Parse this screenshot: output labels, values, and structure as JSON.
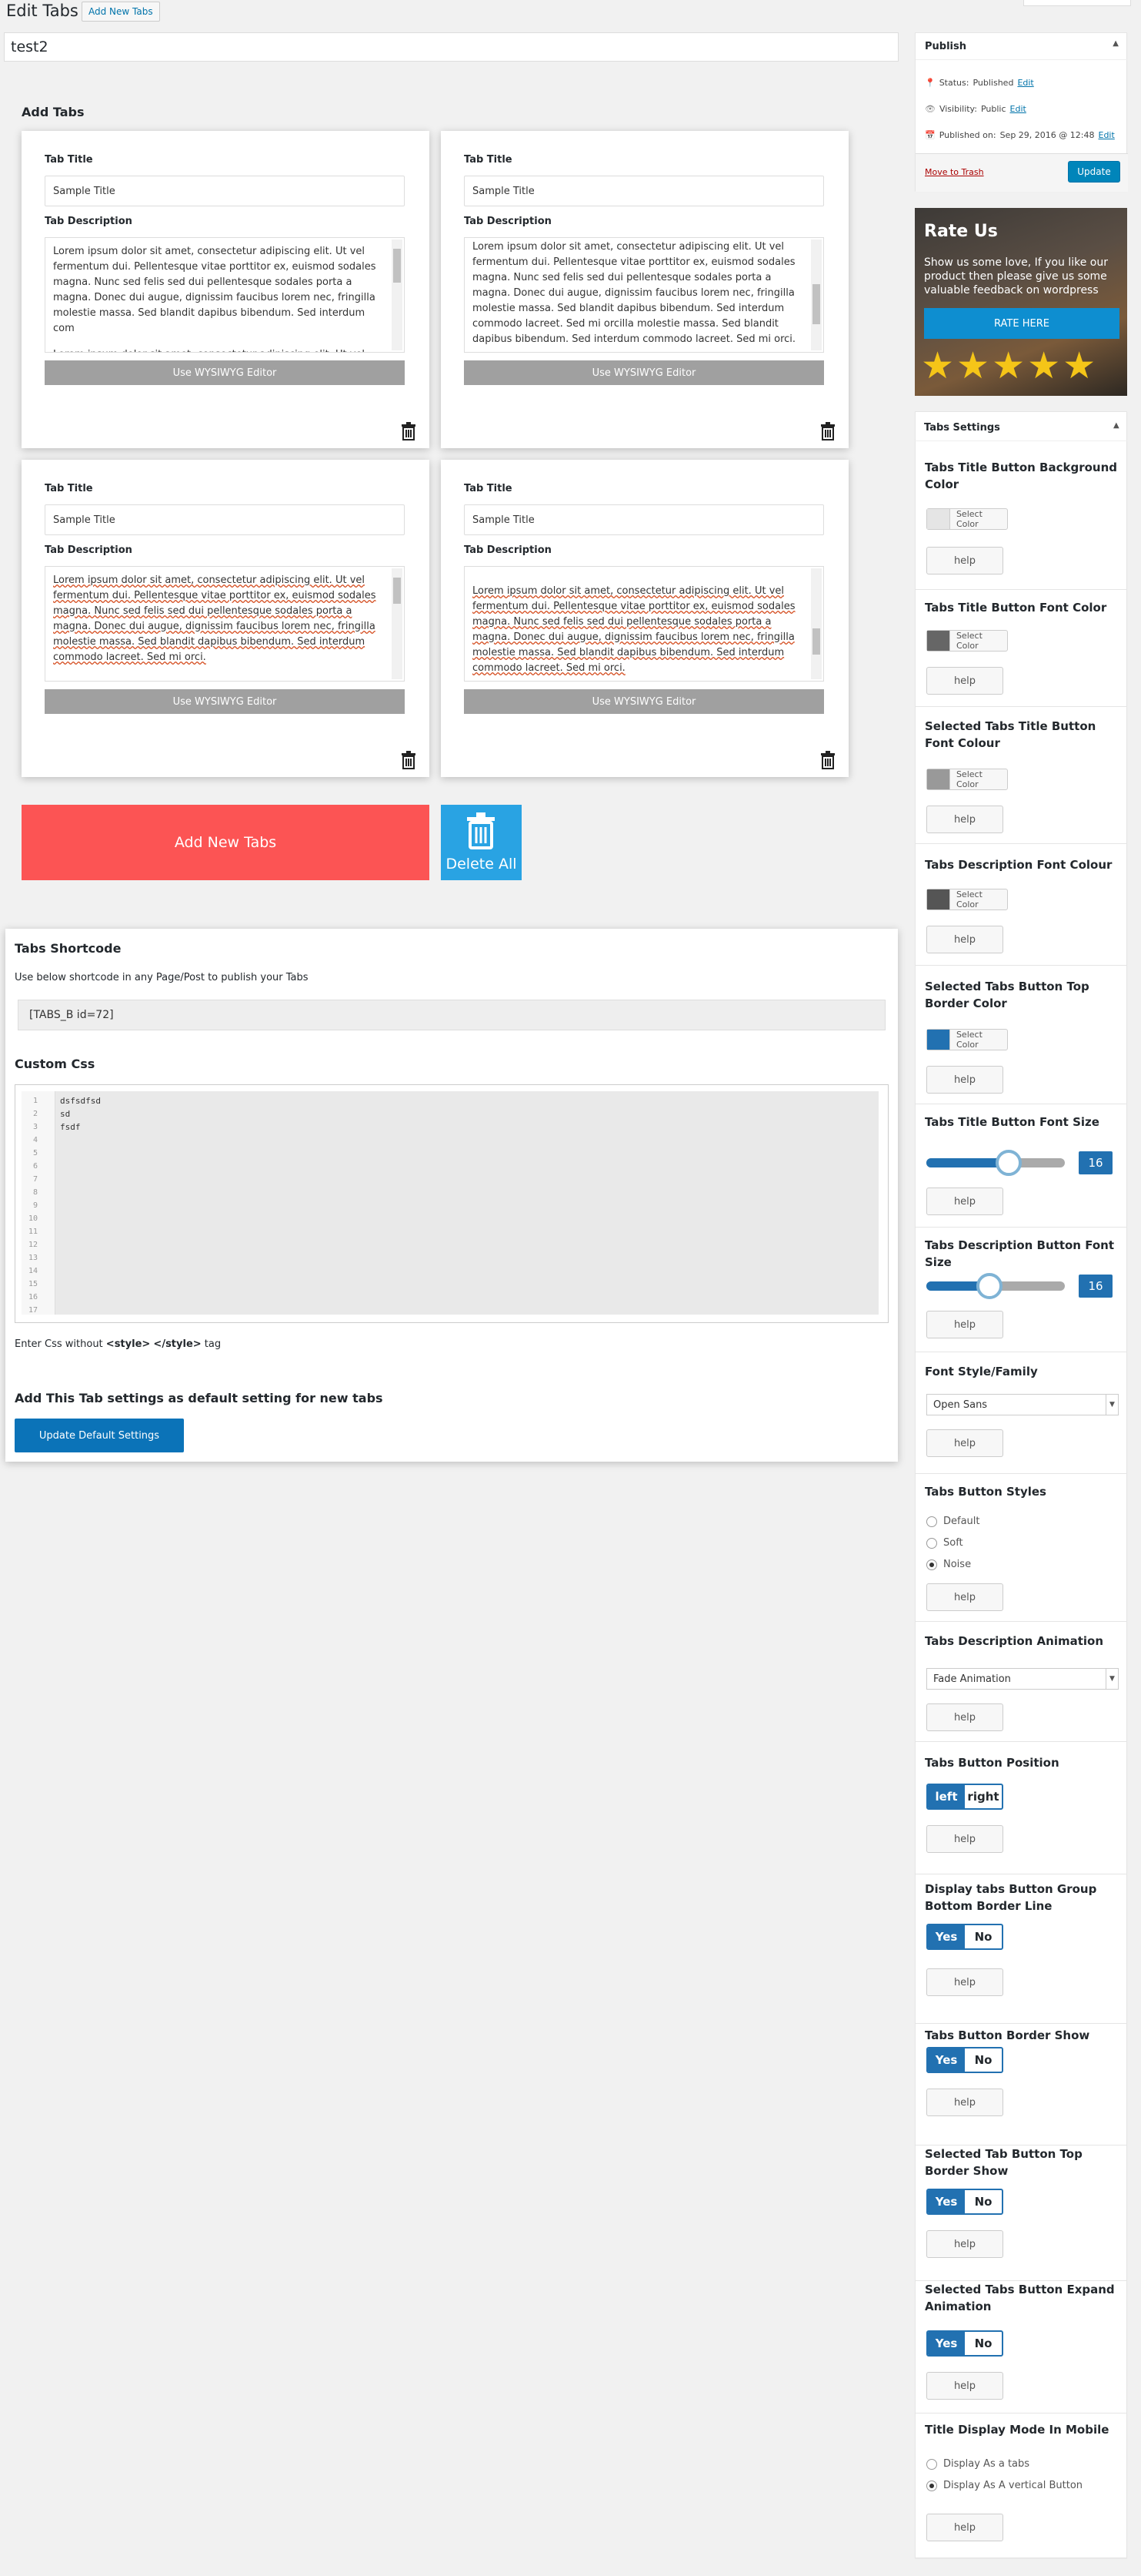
{
  "header": {
    "title": "Edit Tabs",
    "add_new": "Add New Tabs"
  },
  "post_title": "test2",
  "add_tabs_heading": "Add Tabs",
  "tab_labels": {
    "title": "Tab Title",
    "description": "Tab Description",
    "wysiwyg": "Use WYSIWYG Editor"
  },
  "tabs": [
    {
      "title_value": "Sample Title",
      "description": "Lorem ipsum dolor sit amet, consectetur adipiscing elit. Ut vel fermentum dui. Pellentesque vitae porttitor ex, euismod sodales magna. Nunc sed felis sed dui pellentesque sodales porta a magna. Donec dui augue, dignissim faucibus lorem nec, fringilla molestie massa. Sed blandit dapibus bibendum. Sed interdum com",
      "description_cont": "Lorem ipsum dolor sit amet, consectetur adipiscing elit. Ut vel"
    },
    {
      "title_value": "Sample Title",
      "description": "Lorem ipsum dolor sit amet, consectetur adipiscing elit. Ut vel fermentum dui. Pellentesque vitae porttitor ex, euismod sodales magna. Nunc sed felis sed dui pellentesque sodales porta a magna. Donec dui augue, dignissim faucibus lorem nec, fringilla molestie massa. Sed blandit dapibus bibendum. Sed interdum commodo lacreet. Sed mi orcilla molestie massa. Sed blandit dapibus bibendum. Sed interdum commodo lacreet. Sed mi orci."
    },
    {
      "title_value": "Sample Title",
      "description": "Lorem ipsum dolor sit amet, consectetur adipiscing elit. Ut vel fermentum dui. Pellentesque vitae porttitor ex, euismod sodales magna. Nunc sed felis sed dui pellentesque sodales porta a magna. Donec dui augue, dignissim faucibus lorem nec, fringilla molestie massa. Sed blandit dapibus bibendum. Sed interdum commodo lacreet. Sed mi orci."
    },
    {
      "title_value": "Sample Title",
      "description": "Lorem ipsum dolor sit amet, consectetur adipiscing elit. Ut vel fermentum dui. Pellentesque vitae porttitor ex, euismod sodales magna. Nunc sed felis sed dui pellentesque sodales porta a magna. Donec dui augue, dignissim faucibus lorem nec, fringilla molestie massa. Sed blandit dapibus bibendum. Sed interdum commodo lacreet. Sed mi orci."
    }
  ],
  "add_new_tabs_button": "Add New Tabs",
  "delete_all_button": "Delete All",
  "shortcode": {
    "heading": "Tabs Shortcode",
    "desc": "Use below shortcode in any Page/Post to publish your Tabs",
    "value": "[TABS_B id=72]",
    "css_heading": "Custom Css",
    "css_lines": [
      "dsfsdfsd",
      "sd",
      "fsdf"
    ],
    "line_numbers": [
      "1",
      "2",
      "3",
      "4",
      "5",
      "6",
      "7",
      "8",
      "9",
      "10",
      "11",
      "12",
      "13",
      "14",
      "15",
      "16",
      "17"
    ],
    "css_note_pre": "Enter Css without ",
    "css_note_tag1": "<style>",
    "css_note_tag2": "</style>",
    "css_note_post": " tag",
    "default_heading": "Add This Tab settings as default setting for new tabs",
    "default_button": "Update Default Settings"
  },
  "publish": {
    "title": "Publish",
    "status_label": "Status:",
    "status_value": "Published",
    "visibility_label": "Visibility:",
    "visibility_value": "Public",
    "published_label": "Published on:",
    "published_value": "Sep 29, 2016 @ 12:48",
    "edit": "Edit",
    "trash": "Move to Trash",
    "update": "Update"
  },
  "rate": {
    "title": "Rate Us",
    "text": "Show us some love, If you like our product then please give us some valuable feedback on wordpress",
    "button": "RATE HERE",
    "stars": 5
  },
  "settings": {
    "title": "Tabs Settings",
    "help": "help",
    "select_color": "Select Color",
    "title_bg": "Tabs Title Button Background Color",
    "title_font_color": "Tabs Title Button Font Color",
    "selected_title_font": "Selected Tabs Title Button Font Colour",
    "desc_font_color": "Tabs Description Font Colour",
    "selected_top_border": "Selected Tabs Button Top Border Color",
    "title_font_size": "Tabs Title Button Font Size",
    "title_font_size_value": "16",
    "desc_font_size": "Tabs Description Button Font Size",
    "desc_font_size_value": "16",
    "font_family": "Font Style/Family",
    "font_family_value": "Open Sans",
    "button_styles": "Tabs Button Styles",
    "style_options": [
      "Default",
      "Soft",
      "Noise"
    ],
    "desc_animation": "Tabs Description Animation",
    "desc_animation_value": "Fade Animation",
    "button_position": "Tabs Button Position",
    "pos_left": "left",
    "pos_right": "right",
    "group_border": "Display tabs Button Group Bottom Border Line",
    "border_show": "Tabs Button Border Show",
    "selected_top_border_show": "Selected Tab Button Top Border Show",
    "expand_animation": "Selected Tabs Button Expand Animation",
    "yes": "Yes",
    "no": "No",
    "mobile_mode": "Title Display Mode In Mobile",
    "mobile_options": [
      "Display As a tabs",
      "Display As A vertical Button"
    ]
  },
  "colors": {
    "accent": "#2271b1",
    "add_new": "#fc5454",
    "delete": "#29a3e3",
    "trash": "#a00"
  }
}
